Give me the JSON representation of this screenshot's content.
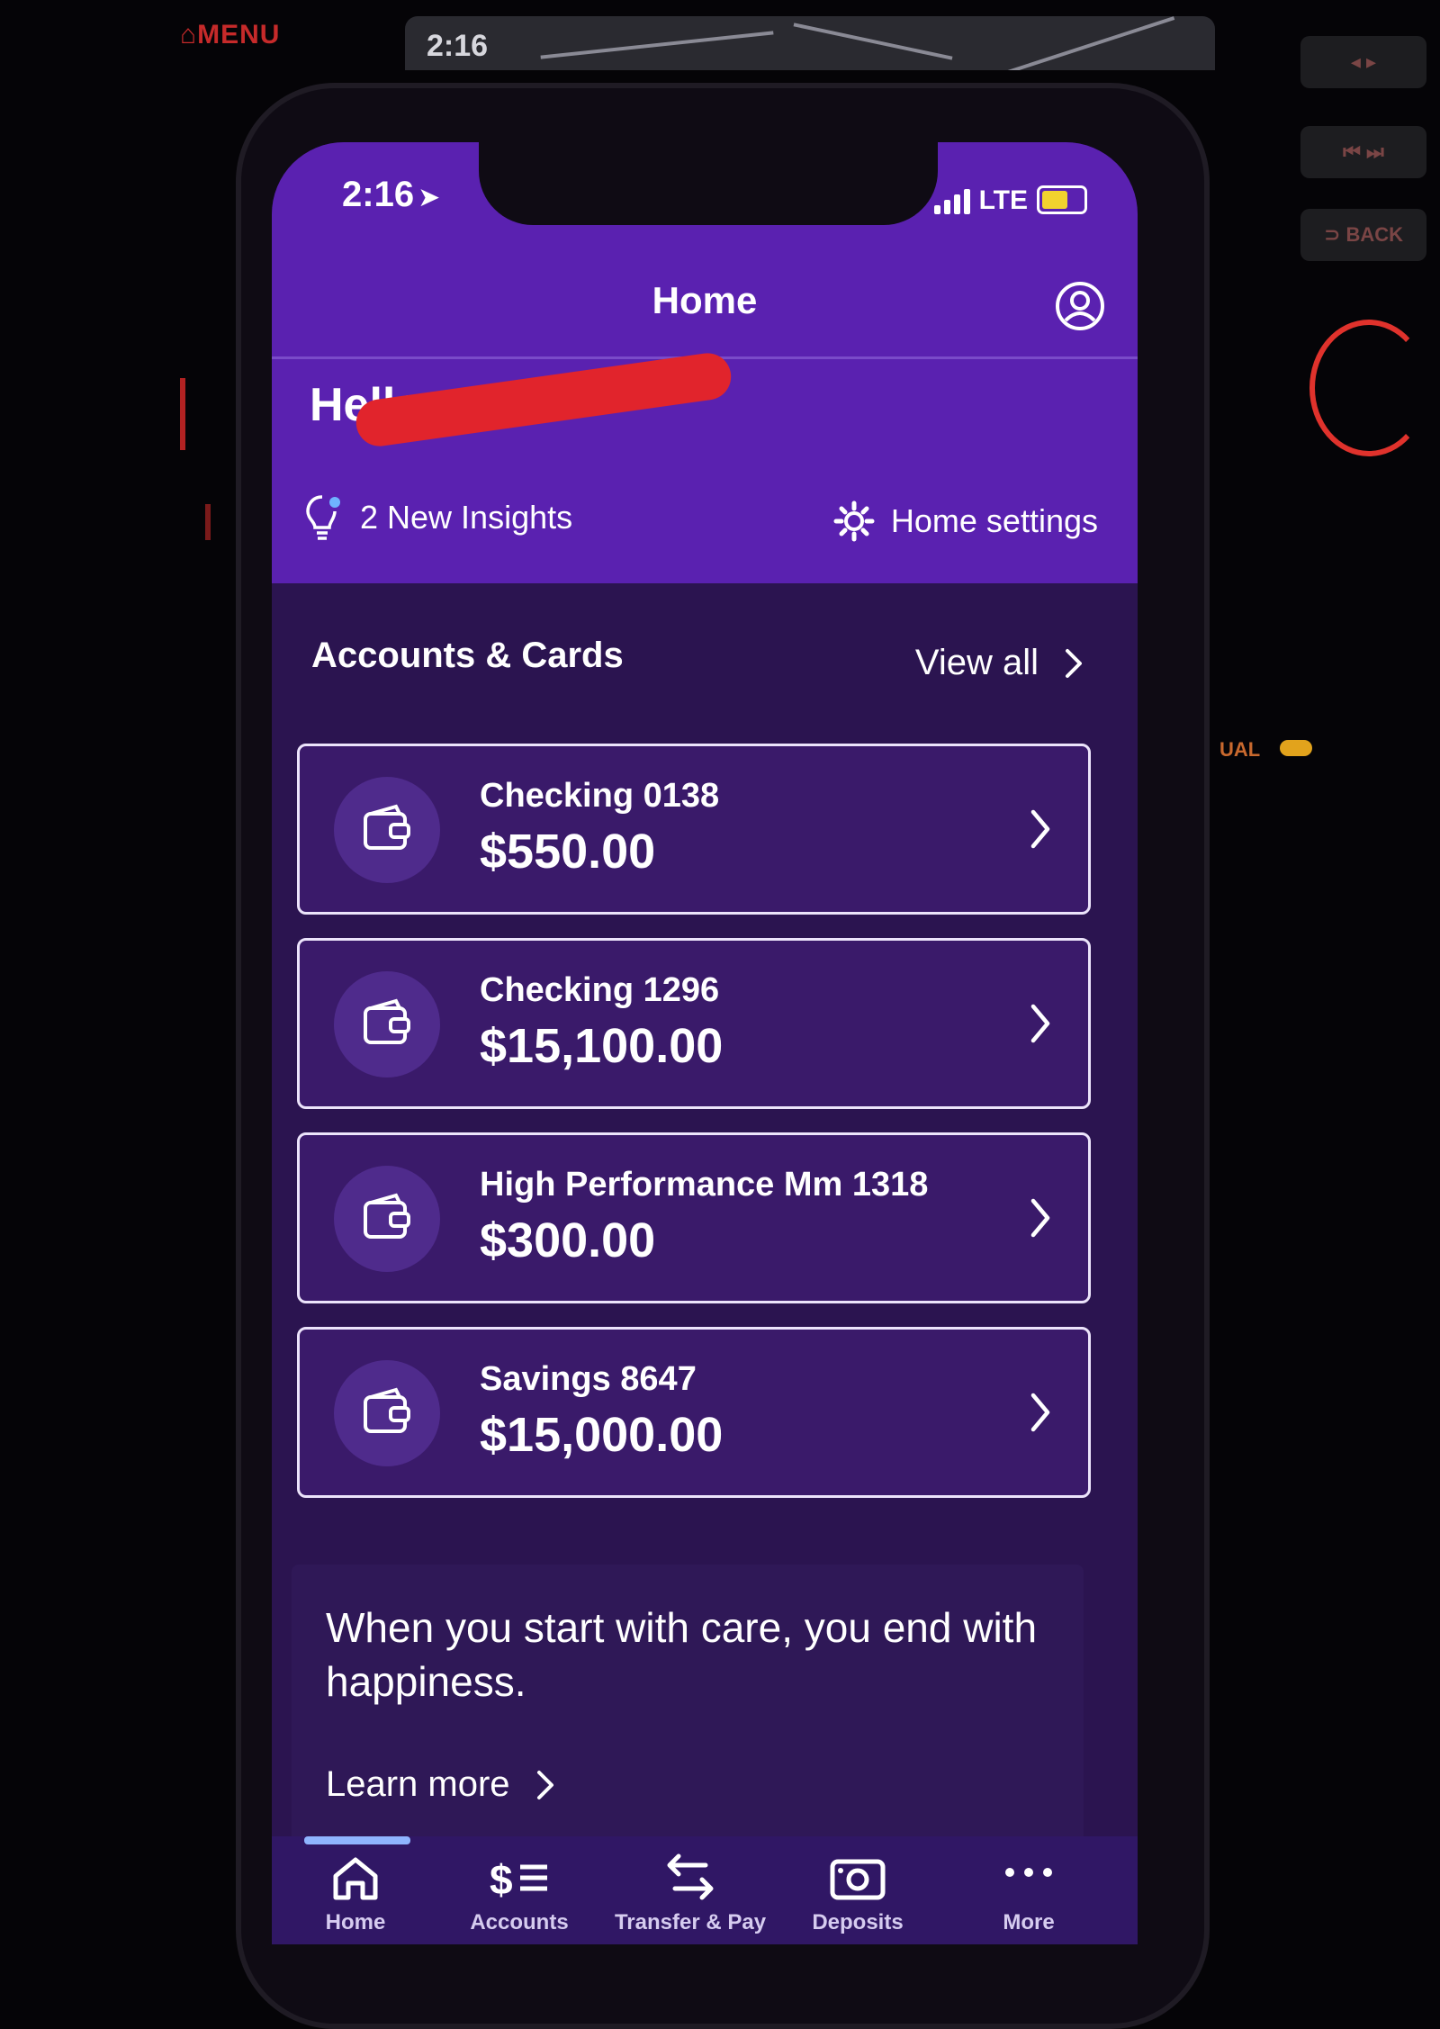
{
  "car": {
    "menu_label": "⌂MENU",
    "screen_time": "2:16",
    "back_label": "⊃ BACK",
    "dash_text": "UAL"
  },
  "status_bar": {
    "time": "2:16",
    "network": "LTE",
    "location_arrow": "➤"
  },
  "header": {
    "title": "Home"
  },
  "greeting": {
    "text": "Hello"
  },
  "insights": {
    "label": "2 New Insights"
  },
  "home_settings": {
    "label": "Home settings"
  },
  "accounts": {
    "section_title": "Accounts & Cards",
    "view_all_label": "View all",
    "items": [
      {
        "name": "Checking 0138",
        "balance": "$550.00"
      },
      {
        "name": "Checking 1296",
        "balance": "$15,100.00"
      },
      {
        "name": "High Performance Mm 1318",
        "balance": "$300.00"
      },
      {
        "name": "Savings 8647",
        "balance": "$15,000.00"
      }
    ]
  },
  "promo": {
    "text": "When you start with care, you end with happiness.",
    "link_label": "Learn more"
  },
  "tabbar": {
    "tabs": [
      {
        "label": "Home",
        "icon": "home-icon",
        "active": true
      },
      {
        "label": "Accounts",
        "icon": "accounts-icon",
        "active": false
      },
      {
        "label": "Transfer & Pay",
        "icon": "transfer-icon",
        "active": false
      },
      {
        "label": "Deposits",
        "icon": "camera-icon",
        "active": false
      },
      {
        "label": "More",
        "icon": "more-icon",
        "active": false
      }
    ]
  },
  "colors": {
    "header_purple": "#5a21b0",
    "body_purple": "#2b1450",
    "card_purple": "#3a1a6a",
    "tab_indicator": "#8fb4ff",
    "battery": "#f2d22e",
    "redaction": "#e1242c"
  }
}
